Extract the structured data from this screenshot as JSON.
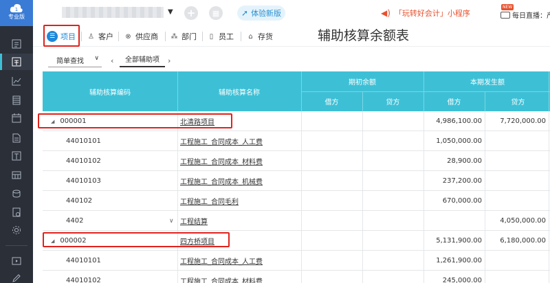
{
  "sidebar": {
    "logo_label": "专业版",
    "icons": [
      "list-icon",
      "voucher-icon",
      "chart-icon",
      "ledger-icon",
      "calendar-icon",
      "document-icon",
      "report-icon",
      "asset-icon",
      "cash-icon",
      "invoice-icon",
      "settings-icon",
      "video-icon",
      "edit-icon"
    ]
  },
  "topbar": {
    "company_name": "",
    "try_new_label": "体验新版",
    "promo_text": "「玩转好会计」小程序",
    "new_badge": "NEW",
    "live_text": "每日直播：产品实"
  },
  "tabs": [
    {
      "label": "项目",
      "icon": "list-icon",
      "active": true
    },
    {
      "label": "客户",
      "icon": "user-icon",
      "active": false
    },
    {
      "label": "供应商",
      "icon": "supplier-icon",
      "active": false
    },
    {
      "label": "部门",
      "icon": "org-icon",
      "active": false
    },
    {
      "label": "员工",
      "icon": "badge-icon",
      "active": false
    },
    {
      "label": "存货",
      "icon": "home-icon",
      "active": false
    }
  ],
  "report_title": "辅助核算余额表",
  "filter": {
    "query_label": "简单查找",
    "scope_label": "全部辅助项"
  },
  "table": {
    "headers": {
      "code": "辅助核算编码",
      "name": "辅助核算名称",
      "opening": "期初余额",
      "current": "本期发生额",
      "debit": "借方",
      "credit": "贷方"
    },
    "rows": [
      {
        "code": "000001",
        "name": "北清路项目",
        "od": "",
        "oc": "",
        "cd": "4,986,100.00",
        "cc": "7,720,000.00",
        "group": true
      },
      {
        "code": "44010101",
        "name": "工程施工_合同成本_人工费",
        "od": "",
        "oc": "",
        "cd": "1,050,000.00",
        "cc": "",
        "group": false
      },
      {
        "code": "44010102",
        "name": "工程施工_合同成本_材料费",
        "od": "",
        "oc": "",
        "cd": "28,900.00",
        "cc": "",
        "group": false
      },
      {
        "code": "44010103",
        "name": "工程施工_合同成本_机械费",
        "od": "",
        "oc": "",
        "cd": "237,200.00",
        "cc": "",
        "group": false
      },
      {
        "code": "440102",
        "name": "工程施工_合同毛利",
        "od": "",
        "oc": "",
        "cd": "670,000.00",
        "cc": "",
        "group": false
      },
      {
        "code": "4402",
        "name": "工程结算",
        "od": "",
        "oc": "",
        "cd": "",
        "cc": "4,050,000.00",
        "group": false
      },
      {
        "code": "000002",
        "name": "四方桥项目",
        "od": "",
        "oc": "",
        "cd": "5,131,900.00",
        "cc": "6,180,000.00",
        "group": true
      },
      {
        "code": "44010101",
        "name": "工程施工_合同成本_人工费",
        "od": "",
        "oc": "",
        "cd": "1,261,900.00",
        "cc": "",
        "group": false
      },
      {
        "code": "44010102",
        "name": "工程施工_合同成本_材料费",
        "od": "",
        "oc": "",
        "cd": "245,000.00",
        "cc": "",
        "group": false
      }
    ]
  },
  "colors": {
    "header_teal": "#3dc0d6",
    "highlight_red": "#e0211b",
    "active_blue": "#1e88d8",
    "rail_dark": "#2a2f38"
  }
}
